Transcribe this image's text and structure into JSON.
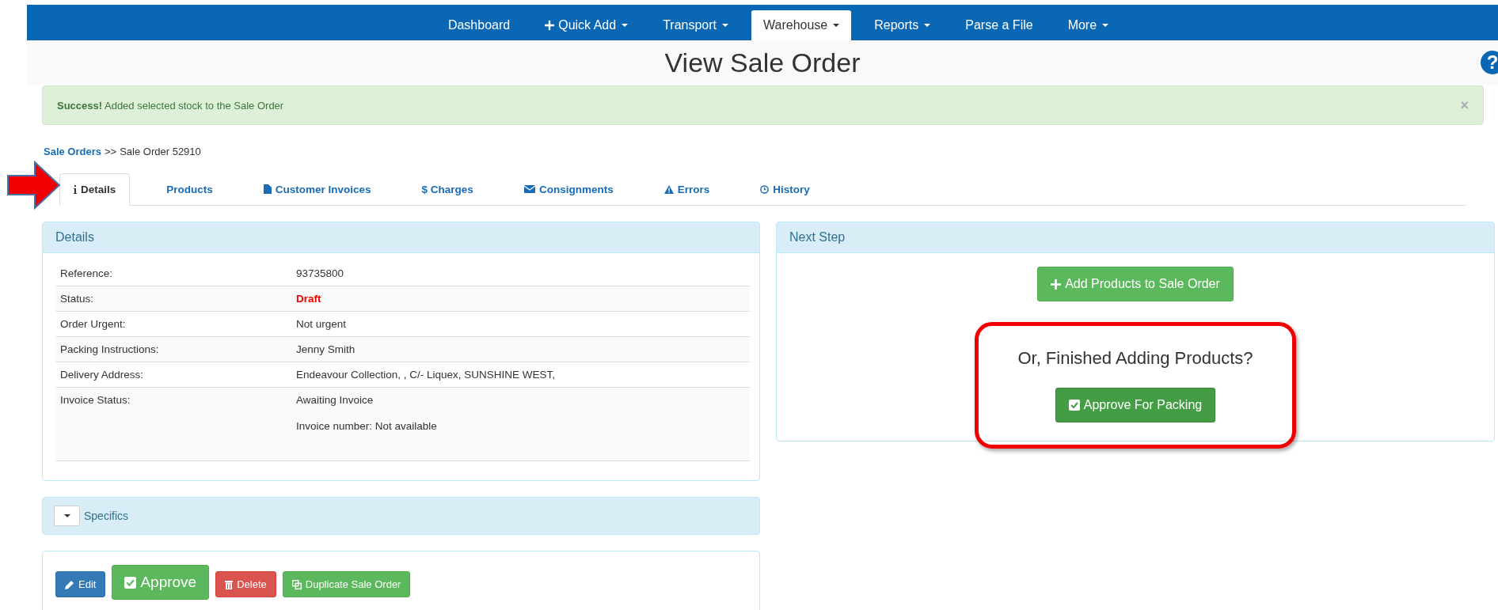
{
  "nav": [
    {
      "label": "Dashboard",
      "kind": "plain",
      "dropdown": false,
      "selected": false
    },
    {
      "label": "Quick Add",
      "kind": "add",
      "dropdown": true,
      "selected": false
    },
    {
      "label": "Transport",
      "kind": "plain",
      "dropdown": true,
      "selected": false
    },
    {
      "label": "Warehouse",
      "kind": "plain",
      "dropdown": true,
      "selected": true
    },
    {
      "label": "Reports",
      "kind": "plain",
      "dropdown": true,
      "selected": false
    },
    {
      "label": "Parse a File",
      "kind": "plain",
      "dropdown": false,
      "selected": false
    },
    {
      "label": "More",
      "kind": "plain",
      "dropdown": true,
      "selected": false
    }
  ],
  "page_title": "View Sale Order",
  "help_glyph": "?",
  "alert": {
    "strong": "Success!",
    "text": "Added selected stock to the Sale Order",
    "close": "×"
  },
  "breadcrumb": {
    "link": "Sale Orders",
    "separator": ">>",
    "current": "Sale Order 52910"
  },
  "tabs": [
    {
      "label": "Details",
      "kind": "info",
      "selected": true
    },
    {
      "label": "Products",
      "kind": "plain",
      "selected": false
    },
    {
      "label": "Customer Invoices",
      "kind": "file",
      "selected": false
    },
    {
      "label": "Charges",
      "kind": "glyph",
      "glyph": "$",
      "selected": false
    },
    {
      "label": "Consignments",
      "kind": "mail",
      "selected": false
    },
    {
      "label": "Errors",
      "kind": "warning",
      "selected": false
    },
    {
      "label": "History",
      "kind": "clock",
      "selected": false
    }
  ],
  "details": {
    "title": "Details",
    "rows": [
      {
        "label": "Reference:",
        "values": [
          "93735800"
        ],
        "emphasis": false
      },
      {
        "label": "Status:",
        "values": [
          "Draft"
        ],
        "emphasis": true
      },
      {
        "label": "Order Urgent:",
        "values": [
          "Not urgent"
        ],
        "emphasis": false
      },
      {
        "label": "Packing Instructions:",
        "values": [
          "Jenny Smith"
        ],
        "emphasis": false
      },
      {
        "label": "Delivery Address:",
        "values": [
          "Endeavour Collection, , C/- Liquex, SUNSHINE WEST,"
        ],
        "emphasis": false
      },
      {
        "label": "Invoice Status:",
        "values": [
          "Awaiting Invoice",
          "Invoice number: Not available"
        ],
        "emphasis": false
      }
    ]
  },
  "specifics": {
    "title": "Specifics",
    "expanded": false
  },
  "actions": [
    {
      "label": "Edit",
      "kind": "edit"
    },
    {
      "label": "Approve",
      "kind": "approve"
    },
    {
      "label": "Delete",
      "kind": "delete"
    },
    {
      "label": "Duplicate Sale Order",
      "kind": "duplicate"
    }
  ],
  "next_step": {
    "title": "Next Step",
    "add_button": "Add Products to Sale Order",
    "question": "Or, Finished Adding Products?",
    "approve_button": "Approve For Packing"
  }
}
